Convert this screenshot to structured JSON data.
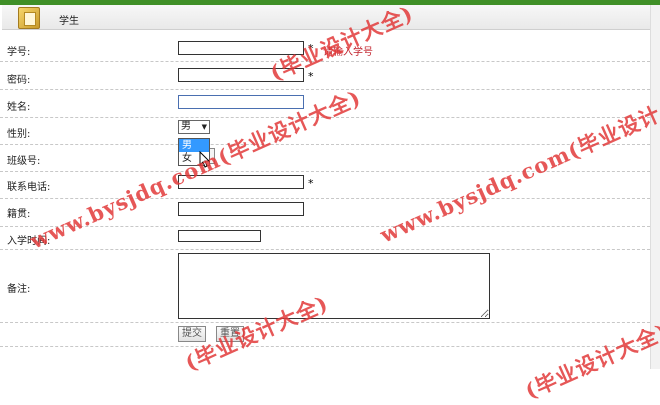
{
  "header": {
    "title": "学生"
  },
  "fields": {
    "student_no": {
      "label": "学号:",
      "required": "*",
      "hint": "请输入学号"
    },
    "password": {
      "label": "密码:",
      "required": "*"
    },
    "name": {
      "label": "姓名:"
    },
    "gender": {
      "label": "性别:",
      "selected": "男",
      "options": [
        "男",
        "女"
      ]
    },
    "class_no": {
      "label": "班级号:"
    },
    "phone": {
      "label": "联系电话:",
      "required": "*"
    },
    "hometown": {
      "label": "籍贯:"
    },
    "enroll_date": {
      "label": "入学时间:"
    },
    "notes": {
      "label": "备注:"
    }
  },
  "buttons": {
    "submit": "提交",
    "reset": "重置"
  },
  "watermarks": [
    "(毕业设计大全)",
    "www.bysjdq.com(毕业设计大全)",
    "www.bysjdq.com(毕业设计",
    "www.bysjdq.com(毕业设计大全)",
    "(毕业设计大全)",
    "(毕业设计大全)",
    "(毕业设计大全)"
  ],
  "colors": {
    "topbar": "#3f8f27",
    "hint": "#c0202a",
    "watermark": "#e23a3a",
    "selected_option": "#3399ff"
  }
}
